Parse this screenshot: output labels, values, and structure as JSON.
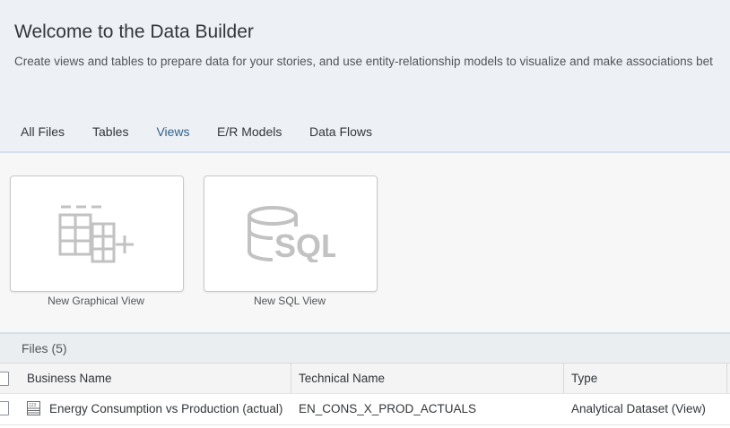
{
  "header": {
    "title": "Welcome to the Data Builder",
    "subtitle": "Create views and tables to prepare data for your stories, and use entity-relationship models to visualize and make associations bet"
  },
  "tabs": [
    {
      "label": "All Files",
      "active": false
    },
    {
      "label": "Tables",
      "active": false
    },
    {
      "label": "Views",
      "active": true
    },
    {
      "label": "E/R Models",
      "active": false
    },
    {
      "label": "Data Flows",
      "active": false
    }
  ],
  "tiles": [
    {
      "label": "New Graphical View",
      "icon": "graphical-view-add-icon"
    },
    {
      "label": "New SQL View",
      "icon": "sql-view-icon",
      "icon_text": "SQL"
    }
  ],
  "files": {
    "title": "Files (5)",
    "columns": [
      "Business Name",
      "Technical Name",
      "Type"
    ],
    "rows": [
      {
        "icon": "analytical-dataset-icon",
        "icon_text": "123",
        "business_name": "Energy Consumption vs Production (actual)",
        "technical_name": "EN_CONS_X_PROD_ACTUALS",
        "type": "Analytical Dataset (View)"
      }
    ]
  },
  "colors": {
    "header_bg": "#edf1f5",
    "active_tab": "#346187",
    "icon_gray": "#c2c2c2"
  }
}
